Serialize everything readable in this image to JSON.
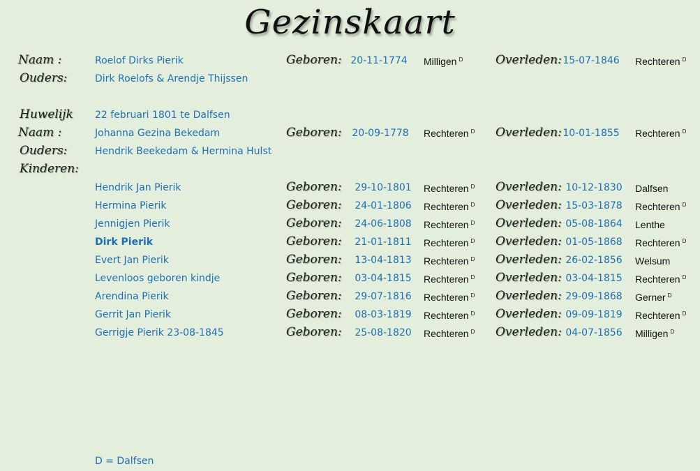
{
  "title": "Gezinskaart",
  "labels": {
    "naam": "Naam :",
    "ouders": "Ouders:",
    "huwelijk": "Huwelijk",
    "kinderen": "Kinderen:",
    "geboren": "Geboren:",
    "overleden": "Overleden:"
  },
  "father": {
    "name": "Roelof Dirks Pierik",
    "birth_date": "20-11-1774",
    "birth_place": "Milligen",
    "birth_place_note": "D",
    "death_date": "15-07-1846",
    "death_place": "Rechteren",
    "death_place_note": "D",
    "parents": "Dirk Roelofs & Arendje Thijssen"
  },
  "marriage": "22 februari 1801 te Dalfsen",
  "mother": {
    "name": "Johanna Gezina Bekedam",
    "birth_date": "20-09-1778",
    "birth_place": "Rechteren",
    "birth_place_note": "D",
    "death_date": "10-01-1855",
    "death_place": "Rechteren",
    "death_place_note": "D",
    "parents": "Hendrik Beekedam & Hermina Hulst"
  },
  "children": [
    {
      "name": "Hendrik Jan Pierik",
      "bold": false,
      "birth_date": "29-10-1801",
      "birth_place": "Rechteren",
      "birth_note": "D",
      "death_date": "10-12-1830",
      "death_place": "Dalfsen",
      "death_note": ""
    },
    {
      "name": "Hermina Pierik",
      "bold": false,
      "birth_date": "24-01-1806",
      "birth_place": "Rechteren",
      "birth_note": "D",
      "death_date": "15-03-1878",
      "death_place": "Rechteren",
      "death_note": "D"
    },
    {
      "name": "Jennigjen Pierik",
      "bold": false,
      "birth_date": "24-06-1808",
      "birth_place": "Rechteren",
      "birth_note": "D",
      "death_date": "05-08-1864",
      "death_place": "Lenthe",
      "death_note": ""
    },
    {
      "name": "Dirk Pierik",
      "bold": true,
      "birth_date": "21-01-1811",
      "birth_place": "Rechteren",
      "birth_note": "D",
      "death_date": "01-05-1868",
      "death_place": "Rechteren",
      "death_note": "D"
    },
    {
      "name": "Evert Jan Pierik",
      "bold": false,
      "birth_date": "13-04-1813",
      "birth_place": "Rechteren",
      "birth_note": "D",
      "death_date": "26-02-1856",
      "death_place": "Welsum",
      "death_note": ""
    },
    {
      "name": "Levenloos geboren kindje",
      "bold": false,
      "birth_date": "03-04-1815",
      "birth_place": "Rechteren",
      "birth_note": "D",
      "death_date": "03-04-1815",
      "death_place": "Rechteren",
      "death_note": "D"
    },
    {
      "name": "Arendina Pierik",
      "bold": false,
      "birth_date": "29-07-1816",
      "birth_place": "Rechteren",
      "birth_note": "D",
      "death_date": "29-09-1868",
      "death_place": "Gerner",
      "death_note": "D"
    },
    {
      "name": "Gerrit Jan Pierik",
      "bold": false,
      "birth_date": "08-03-1819",
      "birth_place": "Rechteren",
      "birth_note": "D",
      "death_date": "09-09-1819",
      "death_place": "Rechteren",
      "death_note": "D"
    },
    {
      "name": "Gerrigje Pierik 23-08-1845",
      "bold": false,
      "birth_date": "25-08-1820",
      "birth_place": "Rechteren",
      "birth_note": "D",
      "death_date": "04-07-1856",
      "death_place": "Milligen",
      "death_note": "D"
    }
  ],
  "legend": "D = Dalfsen",
  "colors": {
    "background": "#e3efdc",
    "link_blue": "#1f6fb5",
    "label": "#1a1a1a"
  }
}
